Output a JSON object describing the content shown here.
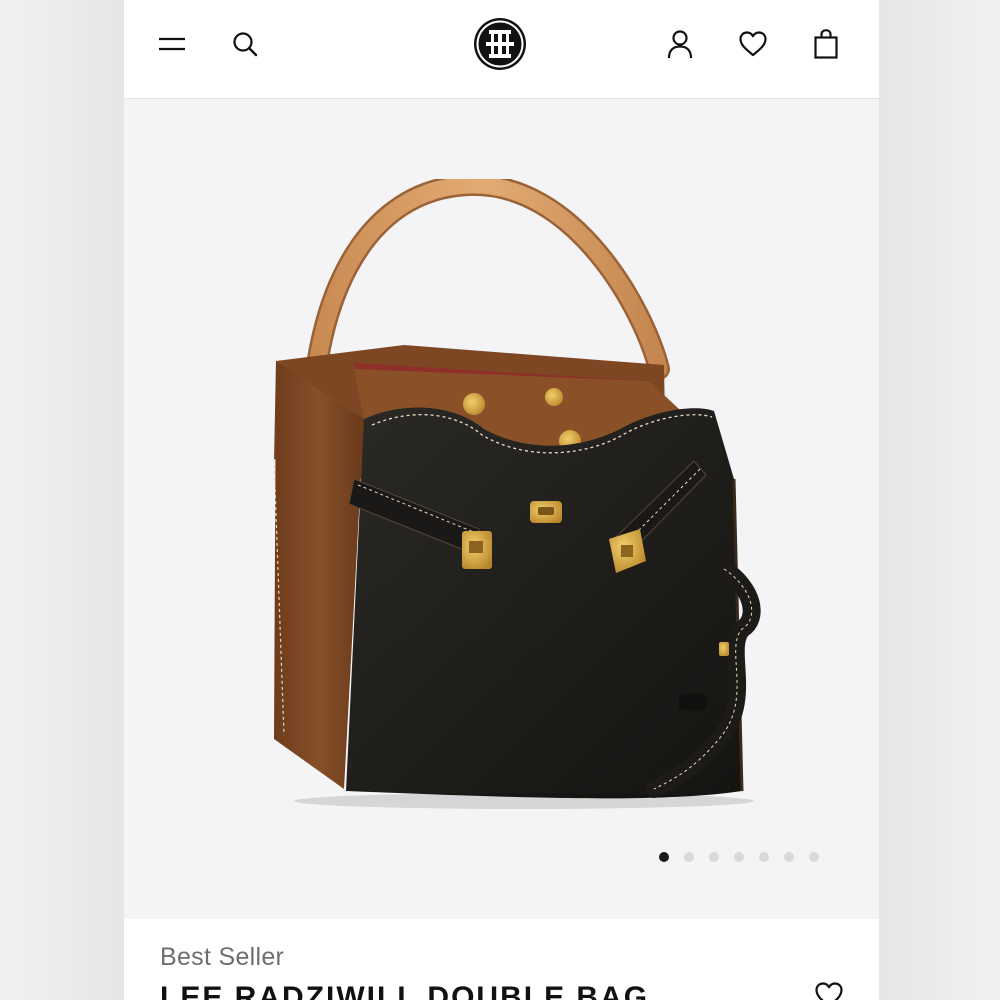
{
  "header": {
    "menu_icon": "hamburger-menu-icon",
    "search_icon": "search-icon",
    "logo": "tory-burch-logo",
    "account_icon": "user-icon",
    "wishlist_icon": "heart-icon",
    "bag_icon": "shopping-bag-icon"
  },
  "product": {
    "badge": "Best Seller",
    "name": "LEE RADZIWILL DOUBLE BAG",
    "image_alt": "",
    "gallery": {
      "total": 7,
      "active_index": 0
    }
  },
  "colors": {
    "background": "#f4f4f6",
    "header_bg": "#ffffff",
    "dot_active": "#1a1a1a",
    "dot_inactive": "#d9d9dc",
    "leather_black": "#1f1e1a",
    "suede_brown": "#7a4521",
    "strap_tan": "#d39a63",
    "hardware_gold": "#c9982f"
  }
}
